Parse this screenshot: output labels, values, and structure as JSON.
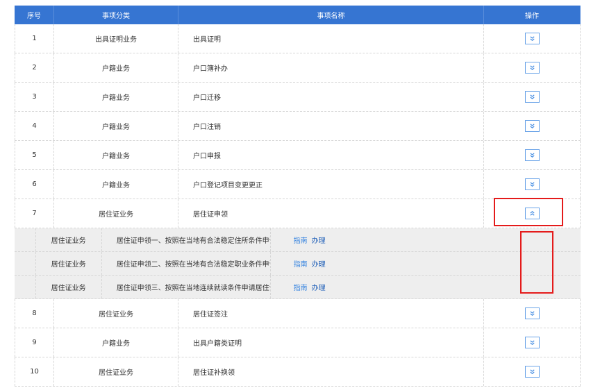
{
  "headers": {
    "no": "序号",
    "category": "事项分类",
    "name": "事项名称",
    "operation": "操作"
  },
  "rows": [
    {
      "no": "1",
      "category": "出具证明业务",
      "name": "出具证明",
      "expanded": false
    },
    {
      "no": "2",
      "category": "户籍业务",
      "name": "户口簿补办",
      "expanded": false
    },
    {
      "no": "3",
      "category": "户籍业务",
      "name": "户口迁移",
      "expanded": false
    },
    {
      "no": "4",
      "category": "户籍业务",
      "name": "户口注销",
      "expanded": false
    },
    {
      "no": "5",
      "category": "户籍业务",
      "name": "户口申报",
      "expanded": false
    },
    {
      "no": "6",
      "category": "户籍业务",
      "name": "户口登记项目变更更正",
      "expanded": false
    },
    {
      "no": "7",
      "category": "居住证业务",
      "name": "居住证申领",
      "expanded": true
    },
    {
      "no": "8",
      "category": "居住证业务",
      "name": "居住证签注",
      "expanded": false
    },
    {
      "no": "9",
      "category": "户籍业务",
      "name": "出具户籍类证明",
      "expanded": false
    },
    {
      "no": "10",
      "category": "居住证业务",
      "name": "居住证补换领",
      "expanded": false
    }
  ],
  "subrows": [
    {
      "category": "居住证业务",
      "name": "居住证申领一、按照在当地有合法稳定住所条件申请居住证的",
      "guide": "指南",
      "handle": "办理"
    },
    {
      "category": "居住证业务",
      "name": "居住证申领二、按照在当地有合法稳定职业条件申请居住证的",
      "guide": "指南",
      "handle": "办理"
    },
    {
      "category": "居住证业务",
      "name": "居住证申领三、按照在当地连续就读条件申请居住证的",
      "guide": "指南",
      "handle": "办理"
    }
  ],
  "icons": {
    "expand": "chevron-double-down-icon",
    "collapse": "chevron-double-up-icon"
  },
  "colors": {
    "header_bg": "#3675d2",
    "link": "#3a86e0",
    "highlight": "#e41b1b",
    "subrow_bg": "#eeeeee"
  }
}
